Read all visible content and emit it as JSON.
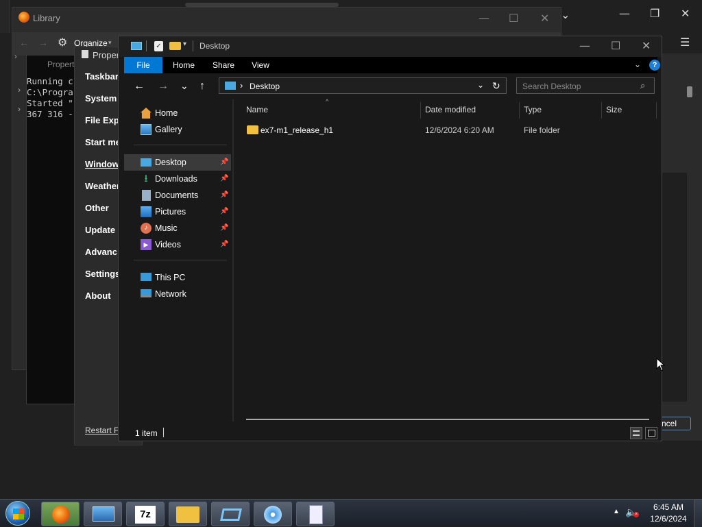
{
  "library": {
    "title": "Library",
    "organize": "Organize",
    "organize_arrow": "▾",
    "o_partial": "C"
  },
  "console": {
    "lines": [
      "Running c",
      "C:\\Progra",
      "Started \"",
      "367 316 -"
    ]
  },
  "props": {
    "title": "Proper",
    "items": [
      "Taskbar",
      "System",
      "File Exp",
      "Start me",
      "Window",
      "Weather",
      "Other",
      "Update",
      "Advanc",
      "Settings",
      "About"
    ],
    "restart": "Restart Fi"
  },
  "rightwin": {
    "cancel": "ncel"
  },
  "bgwin": {
    "tab_title": "Propert"
  },
  "explorer": {
    "title": "Desktop",
    "tabs": {
      "file": "File",
      "home": "Home",
      "share": "Share",
      "view": "View"
    },
    "address": {
      "location": "Desktop",
      "search_placeholder": "Search Desktop"
    },
    "nav": {
      "quick": [
        {
          "label": "Home",
          "icon": "home-icon"
        },
        {
          "label": "Gallery",
          "icon": "gallery-icon"
        }
      ],
      "pinned": [
        {
          "label": "Desktop",
          "icon": "desktop-icon",
          "selected": true
        },
        {
          "label": "Downloads",
          "icon": "download-icon"
        },
        {
          "label": "Documents",
          "icon": "documents-icon"
        },
        {
          "label": "Pictures",
          "icon": "pictures-icon"
        },
        {
          "label": "Music",
          "icon": "music-icon"
        },
        {
          "label": "Videos",
          "icon": "videos-icon"
        }
      ],
      "devices": [
        {
          "label": "This PC",
          "icon": "pc-icon"
        },
        {
          "label": "Network",
          "icon": "network-icon"
        }
      ]
    },
    "columns": {
      "name": "Name",
      "date": "Date modified",
      "type": "Type",
      "size": "Size"
    },
    "files": [
      {
        "name": "ex7-m1_release_h1",
        "date": "12/6/2024 6:20 AM",
        "type": "File folder",
        "size": ""
      }
    ],
    "status": "1 item"
  },
  "taskbar": {
    "time": "6:45 AM",
    "date": "12/6/2024",
    "apps": [
      "firefox-icon",
      "remote-desktop-icon",
      "7zip-icon",
      "file-explorer-icon",
      "virtualbox-icon",
      "cd-burner-icon",
      "task-manager-icon"
    ],
    "sevenzip_label": "7z"
  },
  "colors": {
    "accent": "#0078d4",
    "folder": "#f0c040",
    "selected": "#3a3a3a"
  }
}
